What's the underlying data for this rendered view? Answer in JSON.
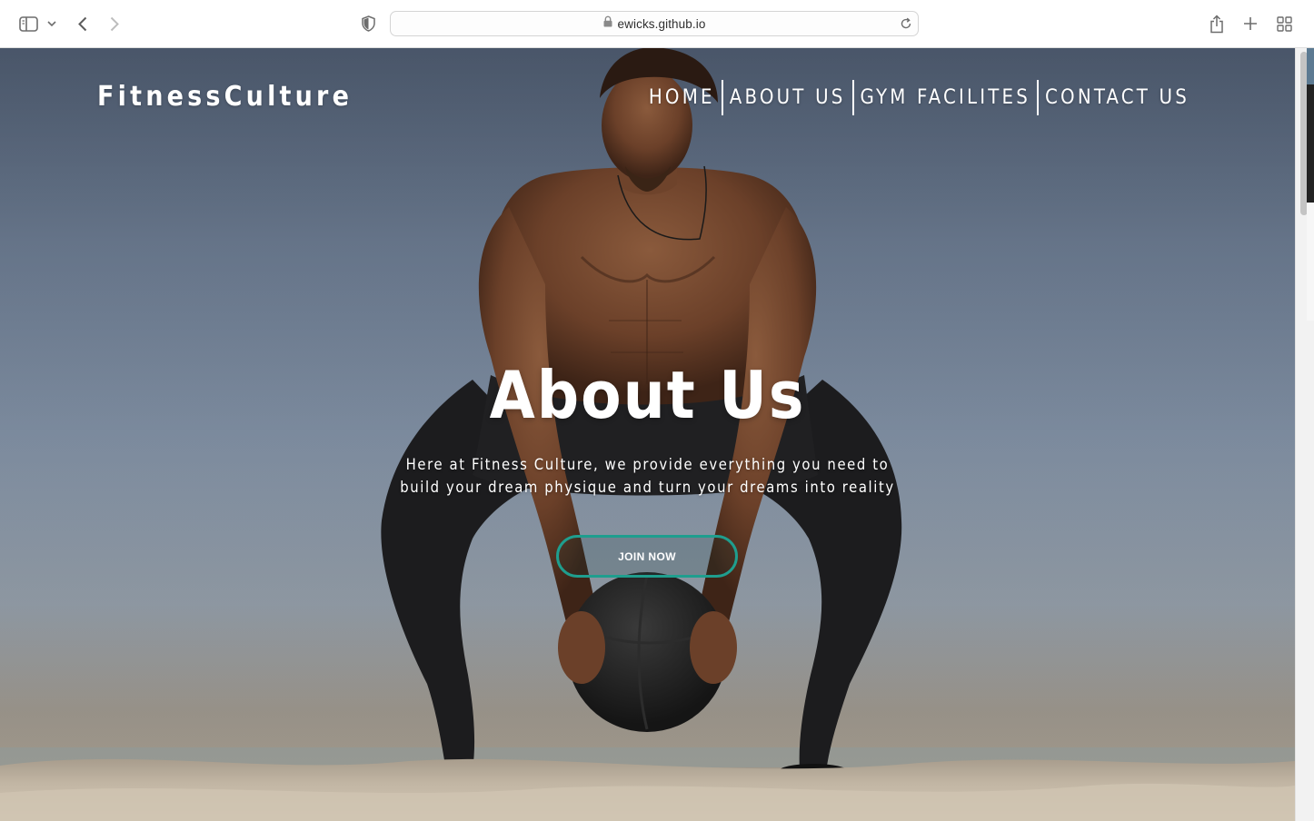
{
  "browser": {
    "url": "ewicks.github.io",
    "icons": [
      "sidebar-icon",
      "chevron-down-icon",
      "back-icon",
      "forward-icon",
      "shield-icon",
      "lock-icon",
      "reload-icon",
      "share-icon",
      "new-tab-icon",
      "tab-overview-icon"
    ]
  },
  "site": {
    "brand": "FitnessCulture",
    "nav": {
      "home": "HOME",
      "about": "ABOUT US",
      "facilities": "GYM FACILITES",
      "contact": "CONTACT US"
    },
    "hero": {
      "title": "About Us",
      "subtitle": "Here at Fitness Culture, we provide everything you need to build your dream physique and turn your dreams into reality",
      "cta": "JOIN NOW"
    }
  },
  "colors": {
    "accent": "#1f9e8e",
    "text": "#ffffff",
    "sky": "#8c9cb0",
    "sand": "#c2b6a4"
  }
}
